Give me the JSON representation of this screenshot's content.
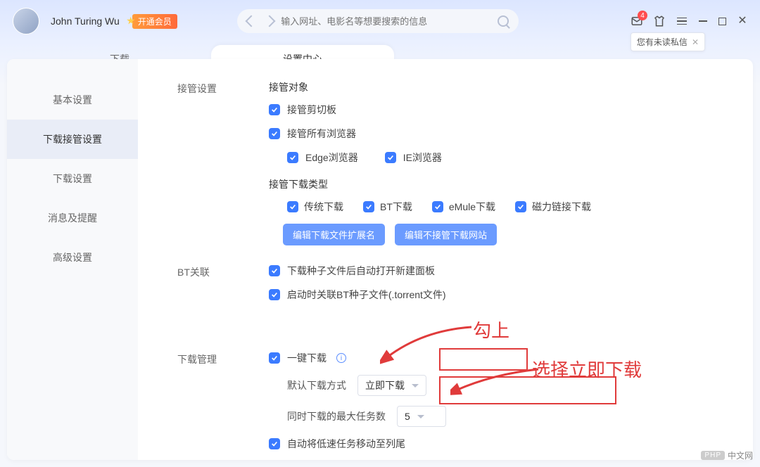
{
  "header": {
    "username": "John Turing Wu",
    "vip_label": "开通会员",
    "search_placeholder": "输入网址、电影名等想要搜索的信息",
    "mail_badge": "4",
    "unread_chip": "您有未读私信"
  },
  "tabs": {
    "download": "下载",
    "settings_center": "设置中心"
  },
  "sidebar": {
    "items": [
      "基本设置",
      "下载接管设置",
      "下载设置",
      "消息及提醒",
      "高级设置"
    ],
    "active_index": 1
  },
  "sections": {
    "takeover": {
      "label": "接管设置",
      "target_head": "接管对象",
      "clipboard": "接管剪切板",
      "all_browsers": "接管所有浏览器",
      "edge": "Edge浏览器",
      "ie": "IE浏览器",
      "type_head": "接管下载类型",
      "trad": "传统下载",
      "bt": "BT下载",
      "emule": "eMule下载",
      "magnet": "磁力链接下载",
      "edit_ext_btn": "编辑下载文件扩展名",
      "edit_skip_btn": "编辑不接管下载网站"
    },
    "bt": {
      "label": "BT关联",
      "open_panel": "下载种子文件后自动打开新建面板",
      "assoc_torrent": "启动时关联BT种子文件(.torrent文件)"
    },
    "dlmgr": {
      "label": "下载管理",
      "one_click": "一键下载",
      "default_mode_label": "默认下载方式",
      "default_mode_value": "立即下载",
      "max_tasks_label": "同时下载的最大任务数",
      "max_tasks_value": "5",
      "move_slow": "自动将低速任务移动至列尾"
    }
  },
  "annotations": {
    "check_it": "勾上",
    "choose_now": "选择立即下载"
  },
  "watermark": "中文网"
}
